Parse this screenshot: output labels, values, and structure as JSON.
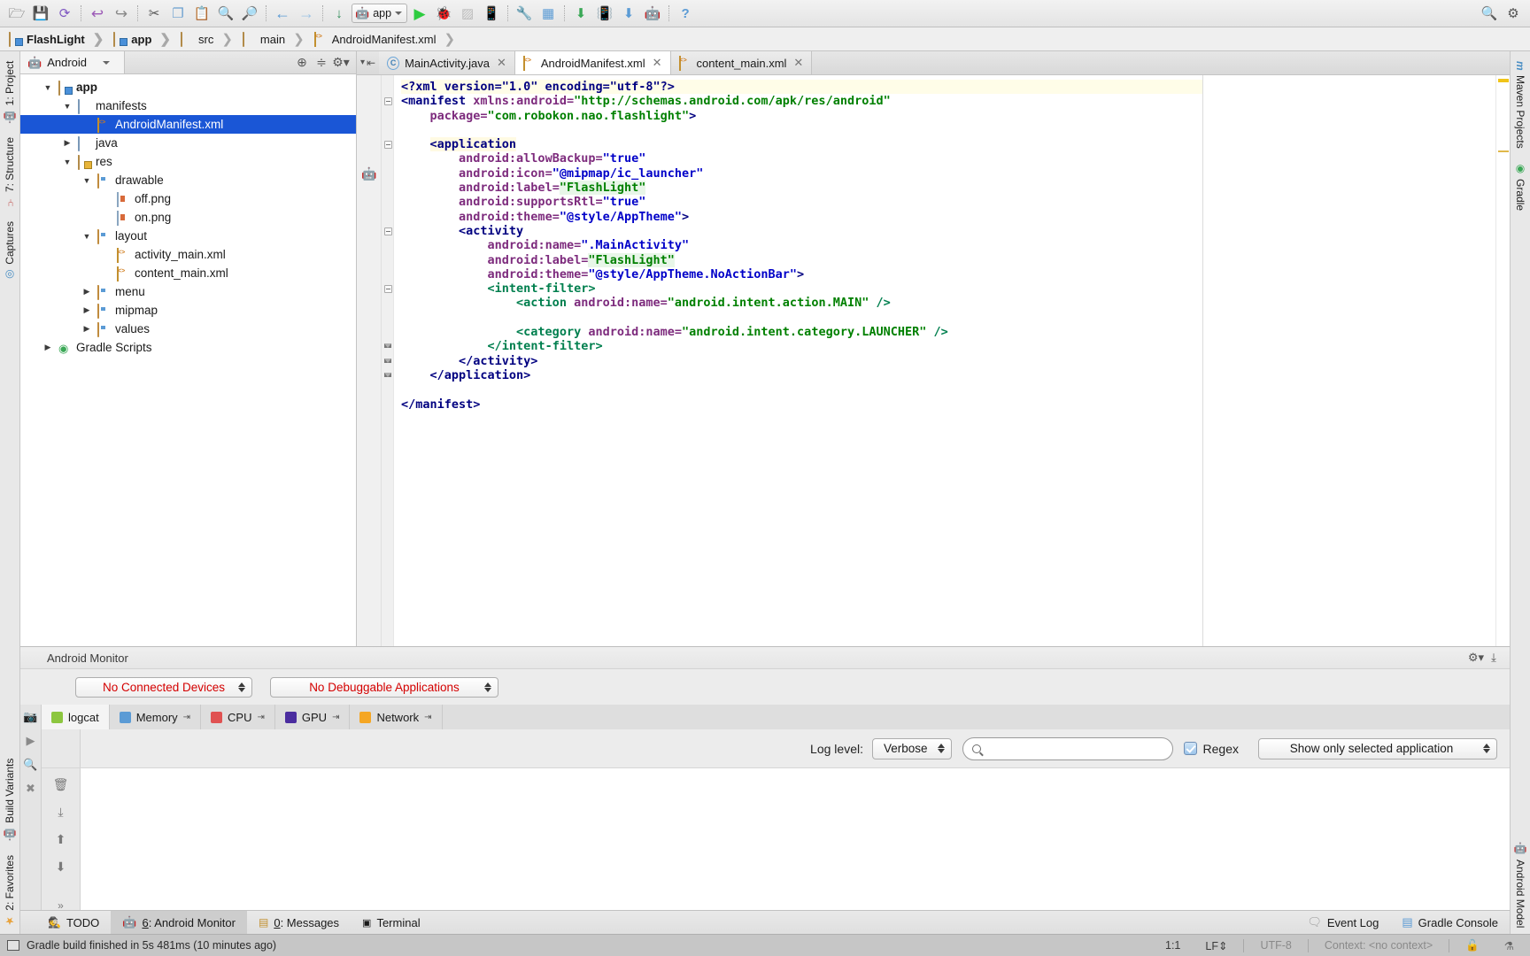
{
  "toolbar": {
    "buttons": [
      {
        "name": "open-folder-icon",
        "glyph": "🗁"
      },
      {
        "name": "save-all-icon",
        "glyph": "💾"
      },
      {
        "name": "sync-icon",
        "glyph": "↺"
      },
      {
        "name": "undo-icon",
        "glyph": "↶"
      },
      {
        "name": "redo-icon",
        "glyph": "↷"
      },
      {
        "name": "cut-icon",
        "glyph": "✂"
      },
      {
        "name": "copy-icon",
        "glyph": "❐"
      },
      {
        "name": "paste-icon",
        "glyph": "📋"
      },
      {
        "name": "find-icon",
        "glyph": "🔍"
      },
      {
        "name": "replace-icon",
        "glyph": "🔎"
      },
      {
        "name": "back-icon",
        "glyph": "←"
      },
      {
        "name": "forward-icon",
        "glyph": "→"
      },
      {
        "name": "compile-icon",
        "glyph": "↓"
      }
    ],
    "right_buttons": [
      {
        "name": "run-icon",
        "glyph": "▶"
      },
      {
        "name": "debug-icon",
        "glyph": "🐞"
      },
      {
        "name": "coverage-icon",
        "glyph": "▓"
      },
      {
        "name": "attach-debugger-icon",
        "glyph": "📱"
      },
      {
        "name": "sdk-manager-icon",
        "glyph": "🔧"
      },
      {
        "name": "avd-manager-icon",
        "glyph": "📲"
      },
      {
        "name": "sync-gradle-icon",
        "glyph": "⬇"
      },
      {
        "name": "device-monitor-icon",
        "glyph": "📳"
      },
      {
        "name": "sdk-update-icon",
        "glyph": "⬇"
      },
      {
        "name": "android-icon",
        "glyph": "🤖"
      },
      {
        "name": "help-icon",
        "glyph": "?"
      }
    ],
    "run_config_label": "app",
    "search_icon": "search-everywhere-icon",
    "settings_icon": "settings-icon"
  },
  "breadcrumbs": [
    {
      "label": "FlashLight",
      "icon": "project-folder-icon",
      "bold": true
    },
    {
      "label": "app",
      "icon": "module-folder-icon",
      "bold": true
    },
    {
      "label": "src",
      "icon": "folder-icon",
      "bold": false
    },
    {
      "label": "main",
      "icon": "folder-icon",
      "bold": false
    },
    {
      "label": "AndroidManifest.xml",
      "icon": "xml-file-icon",
      "bold": false
    }
  ],
  "left_sidebar": {
    "top_tabs": [
      {
        "label": "1: Project",
        "icon": "project-icon"
      },
      {
        "label": "7: Structure",
        "icon": "structure-icon"
      },
      {
        "label": "Captures",
        "icon": "captures-icon"
      }
    ],
    "bottom_tabs": [
      {
        "label": "Build Variants",
        "icon": "android-icon"
      },
      {
        "label": "2: Favorites",
        "icon": "star-icon"
      }
    ]
  },
  "right_sidebar": {
    "top_tabs": [
      {
        "label": "Maven Projects",
        "icon": "maven-icon"
      },
      {
        "label": "Gradle",
        "icon": "gradle-icon"
      }
    ],
    "bottom_tabs": [
      {
        "label": "Android Model",
        "icon": "android-icon"
      }
    ]
  },
  "project_panel": {
    "view_selector": "Android",
    "view_icon": "android-icon",
    "toolbar_icons": [
      {
        "name": "target-icon",
        "glyph": "⊕"
      },
      {
        "name": "collapse-all-icon",
        "glyph": "≃"
      },
      {
        "name": "settings-gear-icon",
        "glyph": "⚙"
      }
    ],
    "tree": [
      {
        "label": "app",
        "depth": 0,
        "twist": "down",
        "icon": "module-folder-icon",
        "bold": true,
        "selected": false
      },
      {
        "label": "manifests",
        "depth": 1,
        "twist": "down",
        "icon": "folder-blue-icon",
        "bold": false,
        "selected": false
      },
      {
        "label": "AndroidManifest.xml",
        "depth": 2,
        "twist": "none",
        "icon": "xml-file-icon",
        "bold": false,
        "selected": true
      },
      {
        "label": "java",
        "depth": 1,
        "twist": "right",
        "icon": "folder-blue-icon",
        "bold": false,
        "selected": false
      },
      {
        "label": "res",
        "depth": 1,
        "twist": "down",
        "icon": "res-folder-icon",
        "bold": false,
        "selected": false
      },
      {
        "label": "drawable",
        "depth": 2,
        "twist": "down",
        "icon": "res-subfolder-icon",
        "bold": false,
        "selected": false
      },
      {
        "label": "off.png",
        "depth": 3,
        "twist": "none",
        "icon": "png-file-icon",
        "bold": false,
        "selected": false
      },
      {
        "label": "on.png",
        "depth": 3,
        "twist": "none",
        "icon": "png-file-icon",
        "bold": false,
        "selected": false
      },
      {
        "label": "layout",
        "depth": 2,
        "twist": "down",
        "icon": "res-subfolder-icon",
        "bold": false,
        "selected": false
      },
      {
        "label": "activity_main.xml",
        "depth": 3,
        "twist": "none",
        "icon": "xml-file-icon",
        "bold": false,
        "selected": false
      },
      {
        "label": "content_main.xml",
        "depth": 3,
        "twist": "none",
        "icon": "xml-file-icon",
        "bold": false,
        "selected": false
      },
      {
        "label": "menu",
        "depth": 2,
        "twist": "right",
        "icon": "res-subfolder-icon",
        "bold": false,
        "selected": false
      },
      {
        "label": "mipmap",
        "depth": 2,
        "twist": "right",
        "icon": "res-subfolder-icon",
        "bold": false,
        "selected": false
      },
      {
        "label": "values",
        "depth": 2,
        "twist": "right",
        "icon": "res-subfolder-icon",
        "bold": false,
        "selected": false
      },
      {
        "label": "Gradle Scripts",
        "depth": 0,
        "twist": "right",
        "icon": "gradle-icon",
        "bold": false,
        "selected": false
      }
    ]
  },
  "editor": {
    "tabs": [
      {
        "label": "MainActivity.java",
        "icon": "java-file-icon",
        "active": false,
        "closable": true
      },
      {
        "label": "AndroidManifest.xml",
        "icon": "xml-file-icon",
        "active": true,
        "closable": true
      },
      {
        "label": "content_main.xml",
        "icon": "xml-file-icon",
        "active": false,
        "closable": true
      }
    ],
    "filename": "AndroidManifest.xml",
    "code_lines": [
      {
        "indent": 0,
        "segments": [
          {
            "t": "<?xml version=\"1.0\" encoding=\"utf-8\"?>",
            "c": "s-pi"
          }
        ],
        "bg": "yellow"
      },
      {
        "indent": 0,
        "segments": [
          {
            "t": "<manifest",
            "c": "s-tag"
          },
          {
            "t": " ",
            "c": ""
          },
          {
            "t": "xmlns:android=",
            "c": "s-attr"
          },
          {
            "t": "\"http://schemas.android.com/apk/res/android\"",
            "c": "s-val-g"
          }
        ]
      },
      {
        "indent": 2,
        "segments": [
          {
            "t": "package=",
            "c": "s-attr"
          },
          {
            "t": "\"com.robokon.nao.flashlight\"",
            "c": "s-val-g"
          },
          {
            "t": ">",
            "c": "s-tag"
          }
        ]
      },
      {
        "indent": 0,
        "segments": []
      },
      {
        "indent": 2,
        "segments": [
          {
            "t": "<application",
            "c": "s-tag hl-yellow"
          }
        ]
      },
      {
        "indent": 4,
        "segments": [
          {
            "t": "android:allowBackup=",
            "c": "s-attr"
          },
          {
            "t": "\"true\"",
            "c": "s-val"
          }
        ]
      },
      {
        "indent": 4,
        "segments": [
          {
            "t": "android:icon=",
            "c": "s-attr"
          },
          {
            "t": "\"@mipmap/ic_launcher\"",
            "c": "s-val"
          }
        ]
      },
      {
        "indent": 4,
        "segments": [
          {
            "t": "android:label=",
            "c": "s-attr"
          },
          {
            "t": "\"FlashLight\"",
            "c": "s-val-g hl-green"
          }
        ]
      },
      {
        "indent": 4,
        "segments": [
          {
            "t": "android:supportsRtl=",
            "c": "s-attr"
          },
          {
            "t": "\"true\"",
            "c": "s-val"
          }
        ]
      },
      {
        "indent": 4,
        "segments": [
          {
            "t": "android:theme=",
            "c": "s-attr"
          },
          {
            "t": "\"@style/AppTheme\"",
            "c": "s-val"
          },
          {
            "t": ">",
            "c": "s-tag"
          }
        ]
      },
      {
        "indent": 4,
        "segments": [
          {
            "t": "<activity",
            "c": "s-tag"
          }
        ]
      },
      {
        "indent": 6,
        "segments": [
          {
            "t": "android:name=",
            "c": "s-attr"
          },
          {
            "t": "\".MainActivity\"",
            "c": "s-val"
          }
        ]
      },
      {
        "indent": 6,
        "segments": [
          {
            "t": "android:label=",
            "c": "s-attr"
          },
          {
            "t": "\"FlashLight\"",
            "c": "s-val-g hl-green"
          }
        ]
      },
      {
        "indent": 6,
        "segments": [
          {
            "t": "android:theme=",
            "c": "s-attr"
          },
          {
            "t": "\"@style/AppTheme.NoActionBar\"",
            "c": "s-val"
          },
          {
            "t": ">",
            "c": "s-tag"
          }
        ]
      },
      {
        "indent": 6,
        "segments": [
          {
            "t": "<intent-filter>",
            "c": "s-tag-g"
          }
        ]
      },
      {
        "indent": 8,
        "segments": [
          {
            "t": "<action",
            "c": "s-tag-g"
          },
          {
            "t": " ",
            "c": ""
          },
          {
            "t": "android:name=",
            "c": "s-attr"
          },
          {
            "t": "\"android.intent.action.MAIN\"",
            "c": "s-val-g"
          },
          {
            "t": " />",
            "c": "s-tag-g"
          }
        ]
      },
      {
        "indent": 0,
        "segments": []
      },
      {
        "indent": 8,
        "segments": [
          {
            "t": "<category",
            "c": "s-tag-g"
          },
          {
            "t": " ",
            "c": ""
          },
          {
            "t": "android:name=",
            "c": "s-attr"
          },
          {
            "t": "\"android.intent.category.LAUNCHER\"",
            "c": "s-val-g"
          },
          {
            "t": " />",
            "c": "s-tag-g"
          }
        ]
      },
      {
        "indent": 6,
        "segments": [
          {
            "t": "</intent-filter>",
            "c": "s-tag-g"
          }
        ]
      },
      {
        "indent": 4,
        "segments": [
          {
            "t": "</activity>",
            "c": "s-tag"
          }
        ]
      },
      {
        "indent": 2,
        "segments": [
          {
            "t": "</application>",
            "c": "s-tag"
          }
        ]
      },
      {
        "indent": 0,
        "segments": []
      },
      {
        "indent": 0,
        "segments": [
          {
            "t": "</manifest>",
            "c": "s-tag"
          }
        ]
      }
    ]
  },
  "monitor": {
    "title": "Android Monitor",
    "header_icons": [
      {
        "name": "monitor-settings-icon",
        "glyph": "⚙"
      },
      {
        "name": "monitor-minimize-icon",
        "glyph": "⤓"
      }
    ],
    "device_selector": "No Connected Devices",
    "process_selector": "No Debuggable Applications",
    "tabs": [
      {
        "label": "logcat",
        "color": "#8cc63f",
        "active": true,
        "detach": false
      },
      {
        "label": "Memory",
        "color": "#5b9bd5",
        "active": false,
        "detach": true
      },
      {
        "label": "CPU",
        "color": "#e05252",
        "active": false,
        "detach": true
      },
      {
        "label": "GPU",
        "color": "#4b2d9f",
        "active": false,
        "detach": true
      },
      {
        "label": "Network",
        "color": "#f5a623",
        "active": false,
        "detach": true
      }
    ],
    "left_icons": [
      {
        "name": "screenshot-icon",
        "glyph": "📷"
      },
      {
        "name": "screen-record-icon",
        "glyph": "▶"
      },
      {
        "name": "layout-inspector-icon",
        "glyph": "🔍"
      },
      {
        "name": "terminate-icon",
        "glyph": "✖"
      }
    ],
    "logcat_icons": [
      {
        "name": "clear-logcat-icon",
        "glyph": "🗑"
      },
      {
        "name": "export-log-icon",
        "glyph": "⬇"
      },
      {
        "name": "scroll-up-icon",
        "glyph": "⬆"
      },
      {
        "name": "scroll-down-icon",
        "glyph": "⬇"
      },
      {
        "name": "more-icon",
        "glyph": "»"
      }
    ],
    "log_level_label": "Log level:",
    "log_level_value": "Verbose",
    "search_value": "",
    "search_placeholder": "",
    "regex_label": "Regex",
    "regex_checked": true,
    "filter_value": "Show only selected application"
  },
  "bottom_tabs": [
    {
      "label": "TODO",
      "prefix": "",
      "icon": "todo-icon",
      "active": false
    },
    {
      "label": ": Android Monitor",
      "prefix": "6",
      "icon": "android-icon",
      "active": true
    },
    {
      "label": ": Messages",
      "prefix": "0",
      "icon": "messages-icon",
      "active": false
    },
    {
      "label": "Terminal",
      "prefix": "",
      "icon": "terminal-icon",
      "active": false
    }
  ],
  "bottom_right": [
    {
      "label": "Event Log",
      "icon": "event-log-icon"
    },
    {
      "label": "Gradle Console",
      "icon": "gradle-console-icon"
    }
  ],
  "status": {
    "message": "Gradle build finished in 5s 481ms (10 minutes ago)",
    "caret": "1:1",
    "line_separator": "LF",
    "encoding": "UTF-8",
    "context": "Context: <no context>",
    "lock_icon": "lock-icon",
    "inspector_icon": "inspection-icon"
  },
  "colors": {
    "selection_blue": "#1a56d6",
    "error_red": "#d40000",
    "android_green": "#8cc63f",
    "tag_navy": "#000080",
    "attr_purple": "#7d2b7d",
    "value_blue": "#0000c8",
    "value_green": "#008000"
  }
}
